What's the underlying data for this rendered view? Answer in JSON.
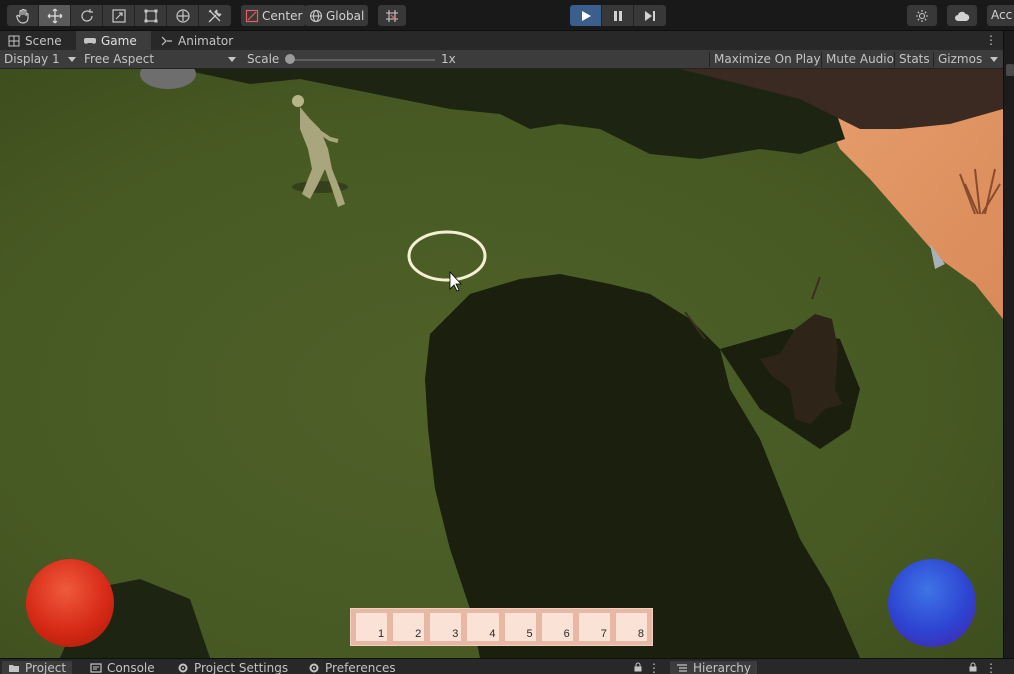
{
  "toolbar": {
    "tools": [
      {
        "name": "hand-tool",
        "icon": "hand-icon"
      },
      {
        "name": "move-tool",
        "icon": "move-arrows-icon",
        "active": true
      },
      {
        "name": "rotate-tool",
        "icon": "rotate-icon"
      },
      {
        "name": "scale-tool",
        "icon": "scale-icon"
      },
      {
        "name": "rect-tool",
        "icon": "rect-transform-icon"
      },
      {
        "name": "transform-tool",
        "icon": "transform-icon"
      },
      {
        "name": "custom-tool",
        "icon": "tools-icon"
      }
    ],
    "pivot_label": "Center",
    "space_label": "Global",
    "account_label": "Acc"
  },
  "tabs": {
    "scene": "Scene",
    "game": "Game",
    "animator": "Animator"
  },
  "gamebar": {
    "display": "Display 1",
    "aspect": "Free Aspect",
    "scale_label": "Scale",
    "scale_value": "1x",
    "maximize": "Maximize On Play",
    "mute": "Mute Audio",
    "stats": "Stats",
    "gizmos": "Gizmos"
  },
  "hotbar": {
    "slots": [
      "1",
      "2",
      "3",
      "4",
      "5",
      "6",
      "7",
      "8"
    ]
  },
  "bottom": {
    "project": "Project",
    "console": "Console",
    "project_settings": "Project Settings",
    "preferences": "Preferences",
    "hierarchy": "Hierarchy"
  },
  "colors": {
    "play_active": "#3a5f8d",
    "grass": "#4a5a26",
    "health_orb": "#d62a16",
    "mana_orb": "#2d44d0"
  }
}
